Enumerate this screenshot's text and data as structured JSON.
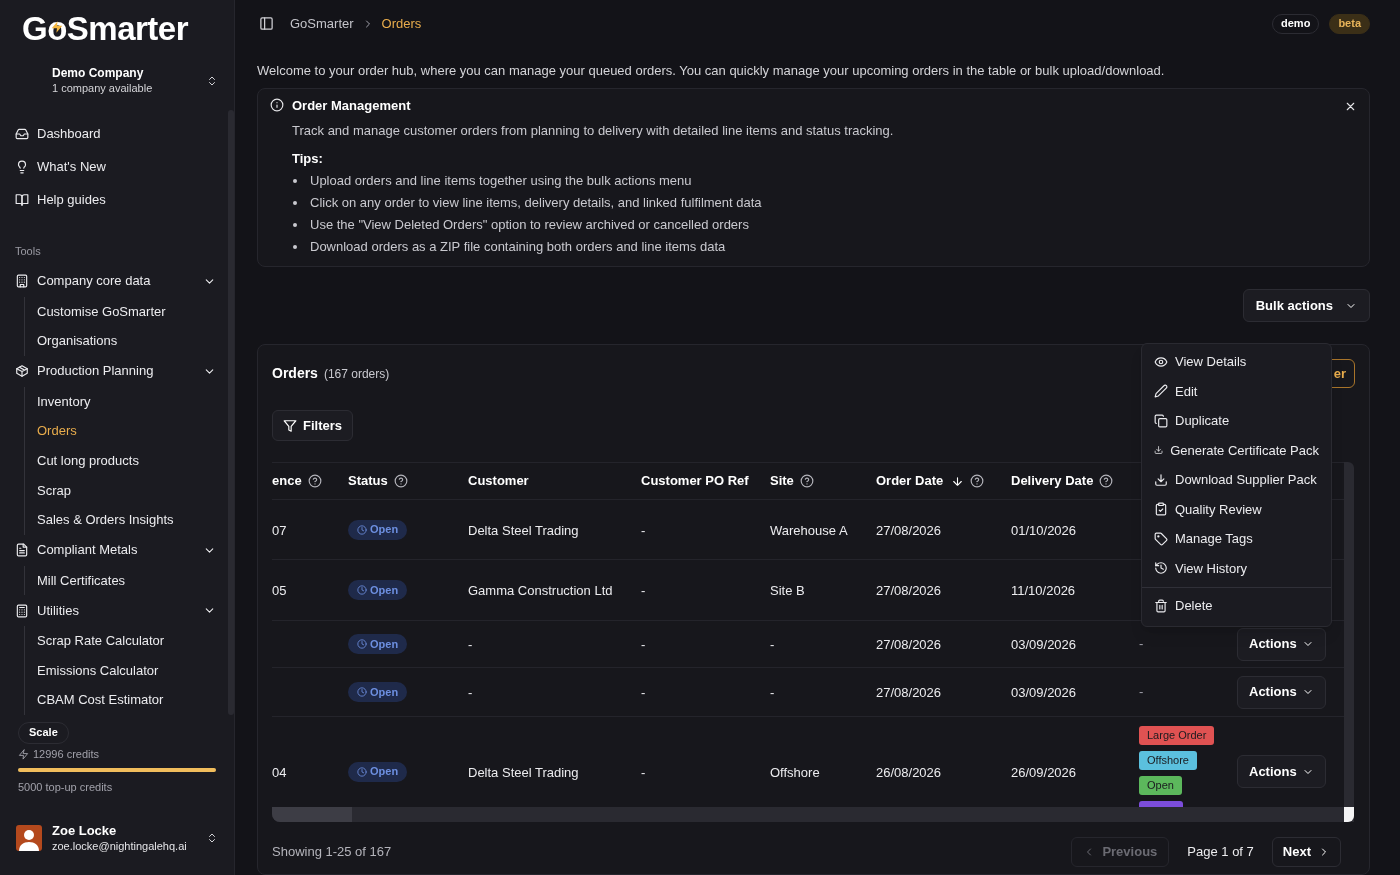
{
  "sidebar": {
    "logo": "GoSmarter",
    "company": {
      "name": "Demo Company",
      "subtitle": "1 company available"
    },
    "nav": [
      {
        "label": "Dashboard"
      },
      {
        "label": "What's New"
      },
      {
        "label": "Help guides"
      }
    ],
    "section_title": "Tools",
    "groups": [
      {
        "label": "Company core data",
        "expanded": true,
        "children": [
          {
            "label": "Customise GoSmarter",
            "selected": false
          },
          {
            "label": "Organisations",
            "selected": false
          }
        ]
      },
      {
        "label": "Production Planning",
        "expanded": true,
        "children": [
          {
            "label": "Inventory",
            "selected": false
          },
          {
            "label": "Orders",
            "selected": true
          },
          {
            "label": "Cut long products",
            "selected": false
          },
          {
            "label": "Scrap",
            "selected": false
          },
          {
            "label": "Sales & Orders Insights",
            "selected": false
          }
        ]
      },
      {
        "label": "Compliant Metals",
        "expanded": true,
        "children": [
          {
            "label": "Mill Certificates",
            "selected": false
          }
        ]
      },
      {
        "label": "Utilities",
        "expanded": true,
        "children": [
          {
            "label": "Scrap Rate Calculator",
            "selected": false
          },
          {
            "label": "Emissions Calculator",
            "selected": false
          },
          {
            "label": "CBAM Cost Estimator",
            "selected": false
          }
        ]
      }
    ],
    "plan": {
      "badge": "Scale",
      "credits": "12996 credits",
      "level": 1,
      "topup": "5000 top-up credits"
    },
    "user": {
      "name": "Zoe Locke",
      "email": "zoe.locke@nightingalehq.ai"
    }
  },
  "header": {
    "breadcrumbs": [
      "GoSmarter",
      "Orders"
    ],
    "badges": [
      {
        "label": "demo",
        "kind": "plain"
      },
      {
        "label": "beta",
        "kind": "accent"
      }
    ]
  },
  "intro": "Welcome to your order hub, where you can manage your queued orders. You can quickly manage your upcoming orders in the table or bulk upload/download.",
  "info_panel": {
    "title": "Order Management",
    "description": "Track and manage customer orders from planning to delivery with detailed line items and status tracking.",
    "tips_title": "Tips:",
    "tips": [
      "Upload orders and line items together using the bulk actions menu",
      "Click on any order to view line items, delivery details, and linked fulfilment data",
      "Use the \"View Deleted Orders\" option to review archived or cancelled orders",
      "Download orders as a ZIP file containing both orders and line items data"
    ]
  },
  "bulk_actions": "Bulk actions",
  "orders": {
    "title": "Orders",
    "count": "(167 orders)",
    "header_button": "er",
    "filters": "Filters",
    "columns": [
      {
        "label": "ence",
        "help": true,
        "sorted": false
      },
      {
        "label": "Status",
        "help": true,
        "sorted": false
      },
      {
        "label": "Customer",
        "help": false,
        "sorted": false
      },
      {
        "label": "Customer PO Ref",
        "help": false,
        "sorted": false
      },
      {
        "label": "Site",
        "help": true,
        "sorted": false
      },
      {
        "label": "Order Date",
        "help": true,
        "sorted": true
      },
      {
        "label": "Delivery Date",
        "help": true,
        "sorted": false
      }
    ],
    "rows": [
      {
        "reference": "07",
        "status": "Open",
        "customer": "Delta Steel Trading",
        "po_ref": "-",
        "site": "Warehouse A",
        "order_date": "27/08/2026",
        "delivery_date": "01/10/2026"
      },
      {
        "reference": "05",
        "status": "Open",
        "customer": "Gamma Construction Ltd",
        "po_ref": "-",
        "site": "Site B",
        "order_date": "27/08/2026",
        "delivery_date": "11/10/2026"
      },
      {
        "status": "Open",
        "customer": "-",
        "po_ref": "-",
        "site": "-",
        "order_date": "27/08/2026",
        "delivery_date": "03/09/2026",
        "tags_text": "-",
        "actions": "Actions"
      },
      {
        "status": "Open",
        "customer": "-",
        "po_ref": "-",
        "site": "-",
        "order_date": "27/08/2026",
        "delivery_date": "03/09/2026",
        "tags_text": "-",
        "actions": "Actions"
      },
      {
        "reference": "04",
        "status": "Open",
        "customer": "Delta Steel Trading",
        "po_ref": "-",
        "site": "Offshore",
        "order_date": "26/08/2026",
        "delivery_date": "26/09/2026",
        "tags": [
          {
            "label": "Large Order",
            "color": "#e05252"
          },
          {
            "label": "Offshore",
            "color": "#5bc0de"
          },
          {
            "label": "Open",
            "color": "#5cb85c"
          },
          {
            "color": "#7c4ddb"
          }
        ],
        "actions": "Actions"
      }
    ],
    "footer": "Showing 1-25 of 167",
    "pagination": {
      "previous": {
        "label": "Previous",
        "disabled": true
      },
      "page": "Page 1 of 7",
      "next": {
        "label": "Next",
        "disabled": false
      }
    }
  },
  "actions_menu": [
    {
      "label": "View Details",
      "separated": false
    },
    {
      "label": "Edit",
      "separated": false
    },
    {
      "label": "Duplicate",
      "separated": false
    },
    {
      "label": "Generate Certificate Pack",
      "separated": false
    },
    {
      "label": "Download Supplier Pack",
      "separated": false
    },
    {
      "label": "Quality Review",
      "separated": false
    },
    {
      "label": "Manage Tags",
      "separated": false
    },
    {
      "label": "View History",
      "separated": false
    },
    {
      "label": "Delete",
      "separated": true
    }
  ]
}
